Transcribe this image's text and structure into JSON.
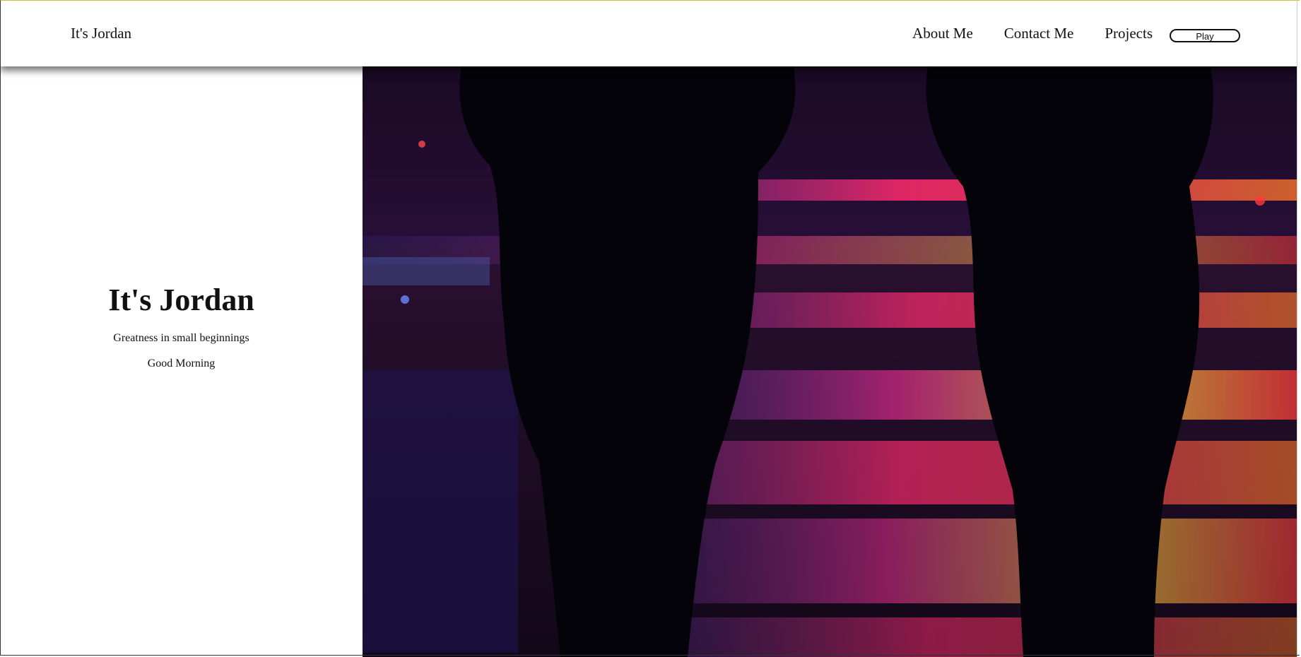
{
  "nav": {
    "brand": "It's Jordan",
    "links": [
      "About Me",
      "Contact Me",
      "Projects"
    ],
    "play_label": "Play"
  },
  "hero": {
    "title": "It's Jordan",
    "tagline": "Greatness in small beginnings",
    "greeting": "Good Morning"
  },
  "media": {
    "icon": "night-street-video",
    "colors": {
      "background": "#0a0612",
      "neon_pink": "#ff2a6d",
      "neon_red": "#ff3b3b",
      "neon_yellow": "#ffd23f",
      "neon_blue": "#3a3aff"
    }
  }
}
